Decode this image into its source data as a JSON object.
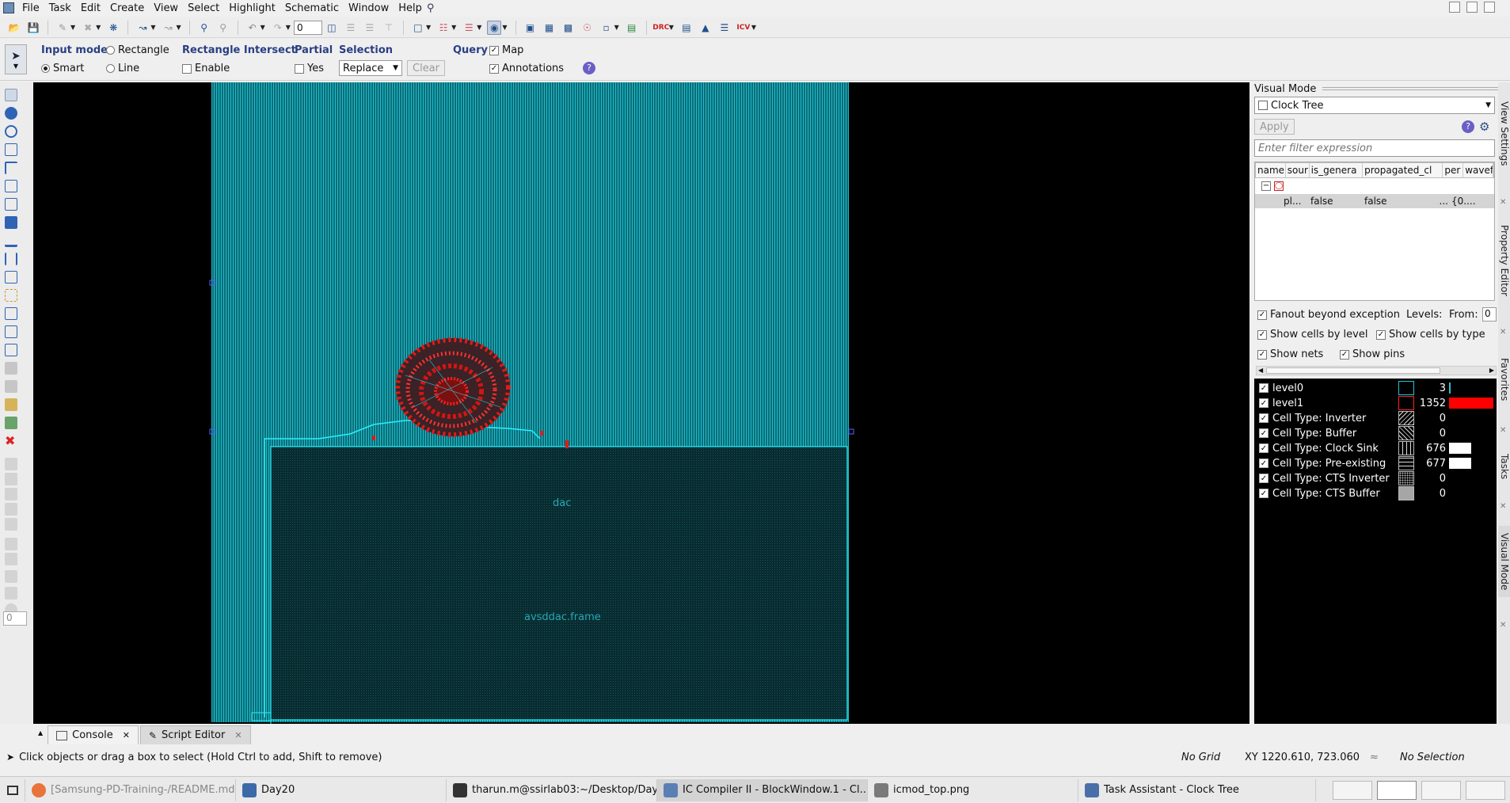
{
  "menubar": {
    "items": [
      "File",
      "Task",
      "Edit",
      "Create",
      "View",
      "Select",
      "Highlight",
      "Schematic",
      "Window",
      "Help"
    ]
  },
  "toolbar": {
    "spin_value": "0"
  },
  "options": {
    "input_mode": {
      "title": "Input mode",
      "rectangle": "Rectangle",
      "smart": "Smart",
      "line": "Line"
    },
    "rect_intersect": {
      "title": "Rectangle Intersect",
      "enable": "Enable"
    },
    "partial": {
      "title": "Partial",
      "yes": "Yes"
    },
    "selection": {
      "title": "Selection",
      "mode": "Replace",
      "clear": "Clear"
    },
    "query": {
      "title": "Query",
      "map": "Map",
      "annotations": "Annotations"
    }
  },
  "left_toolbar": {
    "spin_value": "0"
  },
  "layout": {
    "block_label": "dac",
    "frame_label": "avsddac.frame",
    "colors": {
      "fill": "#0e7a85",
      "grid": "#19c7d6",
      "line": "#29f0ff",
      "cells": "#e01a1a",
      "macro": "#0a2d31"
    }
  },
  "right_panel": {
    "title": "Visual Mode",
    "mode": "Clock Tree",
    "apply": "Apply",
    "filter_placeholder": "Enter filter expression",
    "columns": [
      "name",
      "sour",
      "is_genera",
      "propagated_cl",
      "per",
      "wavef"
    ],
    "row": {
      "name": "pl...",
      "is_generated": "false",
      "propagated": "false",
      "per": "...",
      "wave": "{0...."
    },
    "opt_fanout": "Fanout beyond exception",
    "levels_label": "Levels:",
    "from_label": "From:",
    "from_value": "0",
    "opt_cells_level": "Show cells by level",
    "opt_cells_type": "Show cells by type",
    "opt_nets": "Show nets",
    "opt_pins": "Show pins",
    "legend": [
      {
        "label": "level0",
        "count": "3",
        "color": "#22c4d4",
        "bar_fraction": 0.02
      },
      {
        "label": "level1",
        "count": "1352",
        "color": "#ff0000",
        "bar_fraction": 1.0
      },
      {
        "label": "Cell Type: Inverter",
        "count": "0",
        "pattern": "diag"
      },
      {
        "label": "Cell Type: Buffer",
        "count": "0",
        "pattern": "diag2"
      },
      {
        "label": "Cell Type: Clock Sink",
        "count": "676",
        "pattern": "vert",
        "bar_color": "#ffffff",
        "bar_fraction": 0.5
      },
      {
        "label": "Cell Type: Pre-existing",
        "count": "677",
        "pattern": "horiz",
        "bar_color": "#ffffff",
        "bar_fraction": 0.5
      },
      {
        "label": "Cell Type: CTS Inverter",
        "count": "0",
        "pattern": "dots"
      },
      {
        "label": "Cell Type: CTS Buffer",
        "count": "0",
        "pattern": "dots2"
      }
    ],
    "side_tabs": [
      "View Settings",
      "Property Editor",
      "Favorites",
      "Tasks",
      "Visual Mode"
    ]
  },
  "console_tabs": [
    {
      "label": "Console",
      "icon": "console-icon"
    },
    {
      "label": "Script Editor",
      "icon": "script-editor-icon"
    }
  ],
  "statusbar": {
    "hint": "Click objects or drag a box to select (Hold Ctrl to add, Shift to remove)",
    "grid": "No Grid",
    "xy": "XY 1220.610, 723.060",
    "selection": "No Selection"
  },
  "taskbar": [
    {
      "label": "[Samsung-PD-Training-/README.md...",
      "icon": "firefox-icon",
      "color": "#e8743b"
    },
    {
      "label": "Day20",
      "icon": "folder-icon",
      "color": "#3c6aa8"
    },
    {
      "label": "tharun.m@ssirlab03:~/Desktop/Day...",
      "icon": "terminal-icon",
      "color": "#333333"
    },
    {
      "label": "IC Compiler II - BlockWindow.1 - Cl...",
      "icon": "icc2-icon",
      "color": "#5a7fb5"
    },
    {
      "label": "icmod_top.png",
      "icon": "image-viewer-icon",
      "color": "#7a7a7a"
    },
    {
      "label": "Task Assistant - Clock Tree",
      "icon": "task-assistant-icon",
      "color": "#4a6fa8"
    }
  ]
}
